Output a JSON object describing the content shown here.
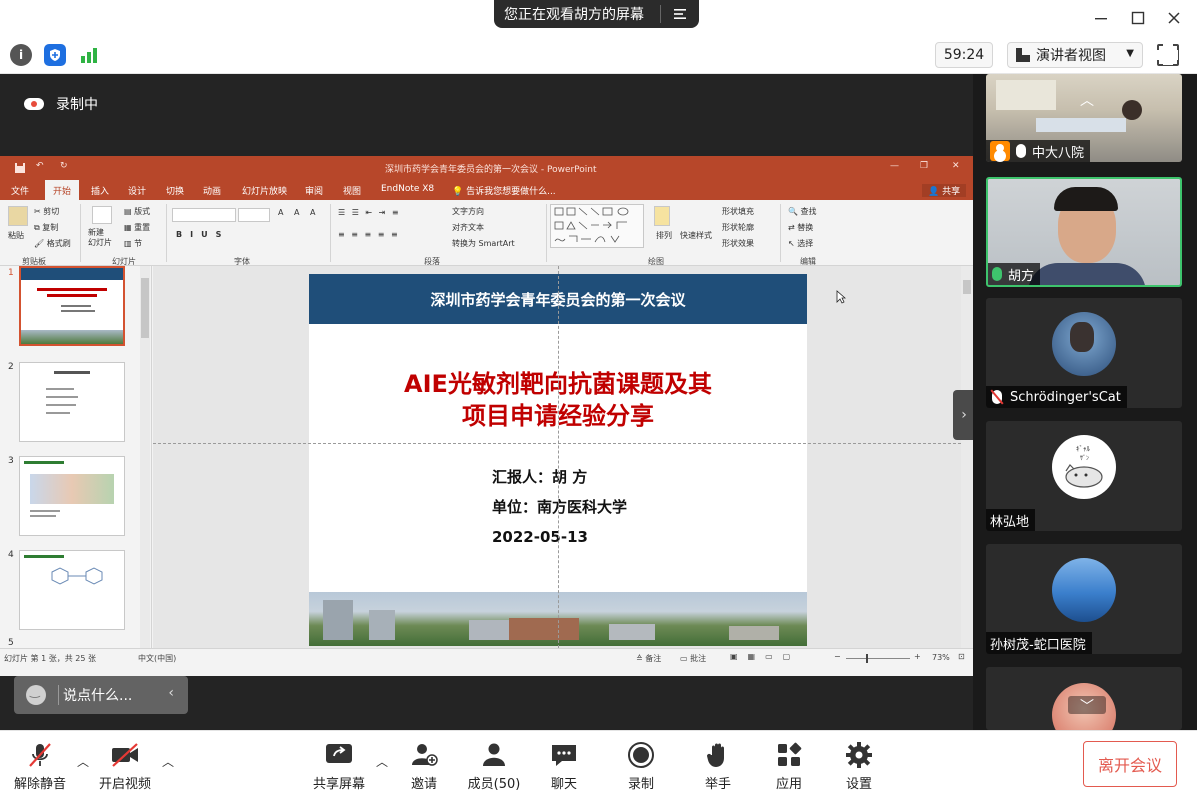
{
  "window": {
    "viewing_banner": "您正在观看胡方的屏幕"
  },
  "toolbar": {
    "timer": "59:24",
    "view_mode": "演讲者视图"
  },
  "share": {
    "recording_label": "录制中",
    "comment_placeholder": "说点什么..."
  },
  "ppt": {
    "window_title": "深圳市药学会青年委员会的第一次会议 - PowerPoint",
    "tabs": [
      "文件",
      "开始",
      "插入",
      "设计",
      "切换",
      "动画",
      "幻灯片放映",
      "审阅",
      "视图",
      "EndNote X8"
    ],
    "tell_me": "告诉我您想要做什么...",
    "share_label": "共享",
    "ribbon_groups": [
      "剪贴板",
      "幻灯片",
      "字体",
      "段落",
      "绘图",
      "编辑"
    ],
    "clipboard": {
      "paste": "粘贴",
      "cut": "剪切",
      "copy": "复制",
      "format_painter": "格式刷"
    },
    "slides_group": {
      "new_slide": "新建\n幻灯片",
      "layout": "版式",
      "reset": "重置",
      "section": "节"
    },
    "paragraph_group": {
      "text_direction": "文字方向",
      "align_text": "对齐文本",
      "smartart": "转换为 SmartArt"
    },
    "drawing_group": {
      "arrange": "排列",
      "quick_styles": "快速样式",
      "shape_fill": "形状填充",
      "shape_outline": "形状轮廓",
      "shape_effects": "形状效果"
    },
    "editing_group": {
      "find": "查找",
      "replace": "替换",
      "select": "选择"
    },
    "slide_numbers": [
      "1",
      "2",
      "3",
      "4",
      "5"
    ],
    "slide": {
      "header": "深圳市药学会青年委员会的第一次会议",
      "title_line1": "AIE光敏剂靶向抗菌课题及其",
      "title_line2": "项目申请经验分享",
      "reporter": "汇报人：胡 方",
      "unit": "单位：南方医科大学",
      "date": "2022-05-13"
    },
    "status": {
      "slide_count": "幻灯片 第 1 张，共 25 张",
      "language": "中文(中国)",
      "notes": "备注",
      "comments": "批注",
      "zoom": "73%"
    }
  },
  "participants": [
    {
      "name": "中大八院",
      "mic": "on",
      "host": true
    },
    {
      "name": "胡方",
      "mic": "speaking",
      "active": true
    },
    {
      "name": "Schrödinger'sCat",
      "mic": "muted"
    },
    {
      "name": "林弘地",
      "mic": "none"
    },
    {
      "name": "孙树茂-蛇口医院",
      "mic": "none"
    }
  ],
  "bottom": {
    "unmute": "解除静音",
    "start_video": "开启视频",
    "share_screen": "共享屏幕",
    "invite": "邀请",
    "members": "成员(50)",
    "chat": "聊天",
    "record": "录制",
    "raise_hand": "举手",
    "apps": "应用",
    "settings": "设置",
    "leave": "离开会议"
  },
  "colors": {
    "ppt_accent": "#b7472a",
    "slide_header": "#1f4e79",
    "slide_title": "#c00000",
    "speaking_green": "#3ec46d",
    "leave_red": "#e35a4f"
  }
}
